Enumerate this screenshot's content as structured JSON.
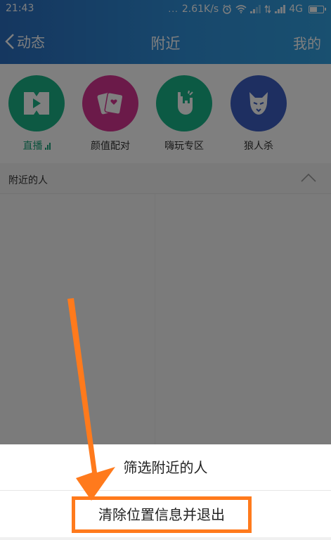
{
  "status_bar": {
    "time": "21:43",
    "dots": "...",
    "speed": "2.61K/s",
    "network": "4G"
  },
  "title_bar": {
    "back_label": "动态",
    "title": "附近",
    "right_label": "我的"
  },
  "entries": [
    {
      "label": "直播",
      "icon": "live-icon",
      "color": "#1bb386",
      "active": true
    },
    {
      "label": "颜值配对",
      "icon": "cards-heart-icon",
      "color": "#d63592"
    },
    {
      "label": "嗨玩专区",
      "icon": "rock-hand-icon",
      "color": "#19b488"
    },
    {
      "label": "狼人杀",
      "icon": "wolf-icon",
      "color": "#3c5fc3"
    }
  ],
  "section": {
    "title": "附近的人",
    "chevron": "chevron-up-icon"
  },
  "action_sheet": {
    "filter_label": "筛选附近的人",
    "clear_label": "清除位置信息并退出"
  },
  "colors": {
    "header_start": "#2a6ec0",
    "header_end": "#32a0e0",
    "highlight": "#ff7a1c",
    "active_green": "#1aa37a"
  }
}
